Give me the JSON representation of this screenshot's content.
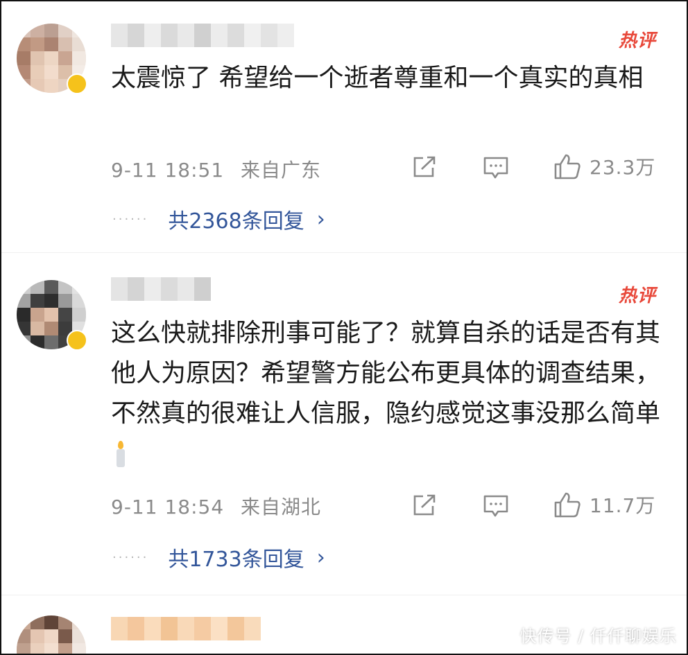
{
  "comments": [
    {
      "hot_label": "热评",
      "text": "太震惊了 希望给一个逝者尊重和一个真实的真相",
      "date": "9-11 18:51",
      "source": "来自广东",
      "likes": "23.3万",
      "replies": "共2368条回复",
      "dots": "······"
    },
    {
      "hot_label": "热评",
      "text": "这么快就排除刑事可能了？就算自杀的话是否有其他人为原因？希望警方能公布更具体的调查结果，不然真的很难让人信服，隐约感觉这事没那么简单",
      "date": "9-11 18:54",
      "source": "来自湖北",
      "likes": "11.7万",
      "replies": "共1733条回复",
      "dots": "······"
    }
  ],
  "watermark": "快传号 / 仟仟聊娱乐",
  "icons": {
    "share": "share-icon",
    "comment": "comment-icon",
    "like": "thumbs-up-icon",
    "candle": "candle-emoji"
  },
  "colors": {
    "hot_label": "#e8483a",
    "reply_link": "#33569a",
    "meta_text": "#8a8a8a"
  }
}
